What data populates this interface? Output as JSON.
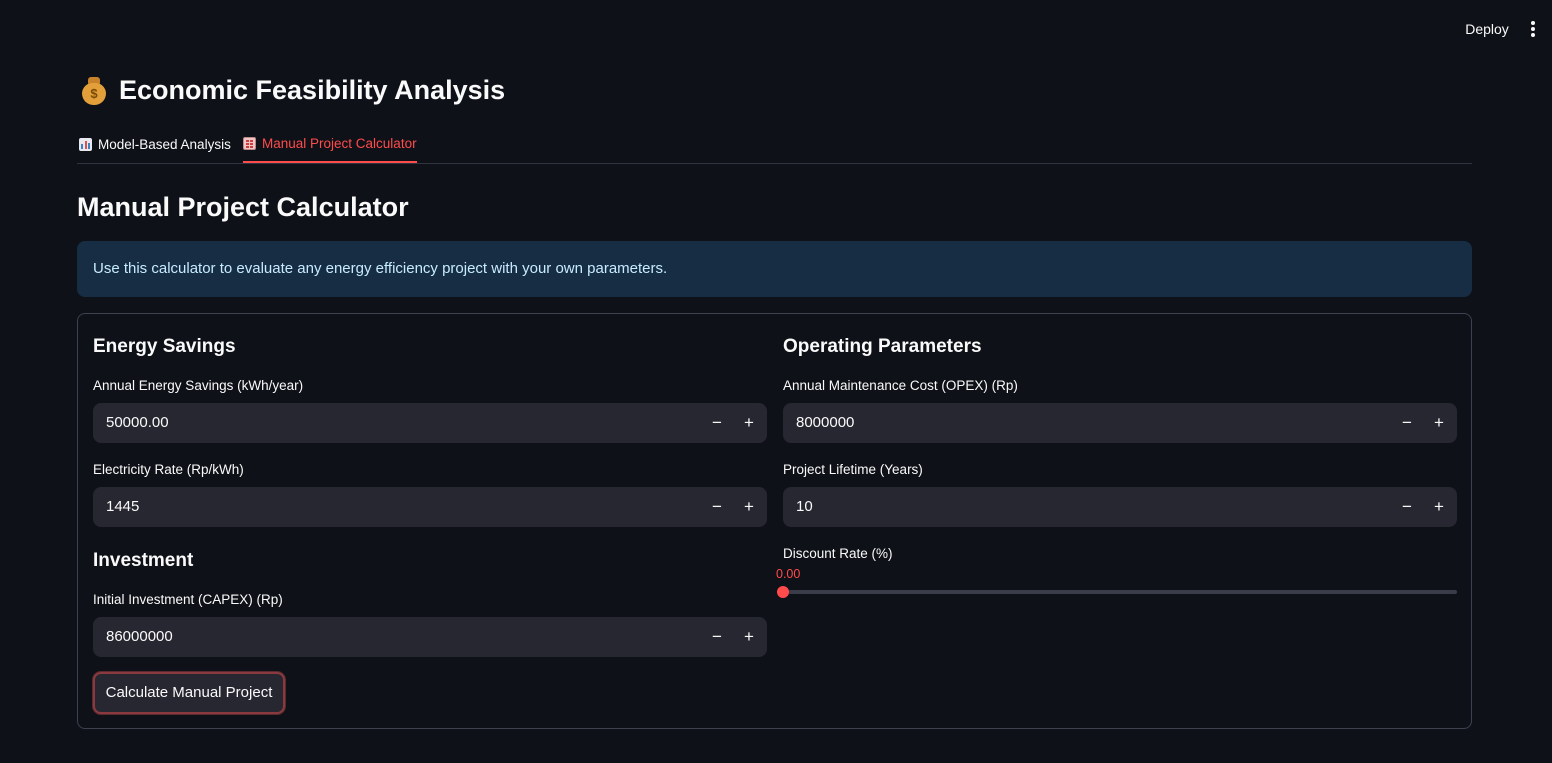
{
  "header": {
    "deploy_label": "Deploy"
  },
  "page": {
    "title": "Economic Feasibility Analysis",
    "title_icon": "money-bag-icon",
    "tabs": [
      {
        "label": "Model-Based Analysis",
        "icon": "bar-chart-icon",
        "active": false
      },
      {
        "label": "Manual Project Calculator",
        "icon": "abacus-icon",
        "active": true
      }
    ],
    "section_title": "Manual Project Calculator",
    "info_text": "Use this calculator to evaluate any energy efficiency project with your own parameters."
  },
  "form": {
    "energy": {
      "heading": "Energy Savings",
      "annual_savings": {
        "label": "Annual Energy Savings (kWh/year)",
        "value": "50000.00"
      },
      "electricity_rate": {
        "label": "Electricity Rate (Rp/kWh)",
        "value": "1445"
      }
    },
    "investment": {
      "heading": "Investment",
      "capex": {
        "label": "Initial Investment (CAPEX) (Rp)",
        "value": "86000000"
      }
    },
    "operating": {
      "heading": "Operating Parameters",
      "opex": {
        "label": "Annual Maintenance Cost (OPEX) (Rp)",
        "value": "8000000"
      },
      "lifetime": {
        "label": "Project Lifetime (Years)",
        "value": "10"
      },
      "discount": {
        "label": "Discount Rate (%)",
        "value": "0.00",
        "fraction": 0
      }
    },
    "controls": {
      "minus": "−",
      "plus": "+"
    },
    "submit_label": "Calculate Manual Project"
  },
  "colors": {
    "accent": "#ff4b4b",
    "background": "#0e1117",
    "input_bg": "#262730",
    "info_bg": "#172d43"
  }
}
